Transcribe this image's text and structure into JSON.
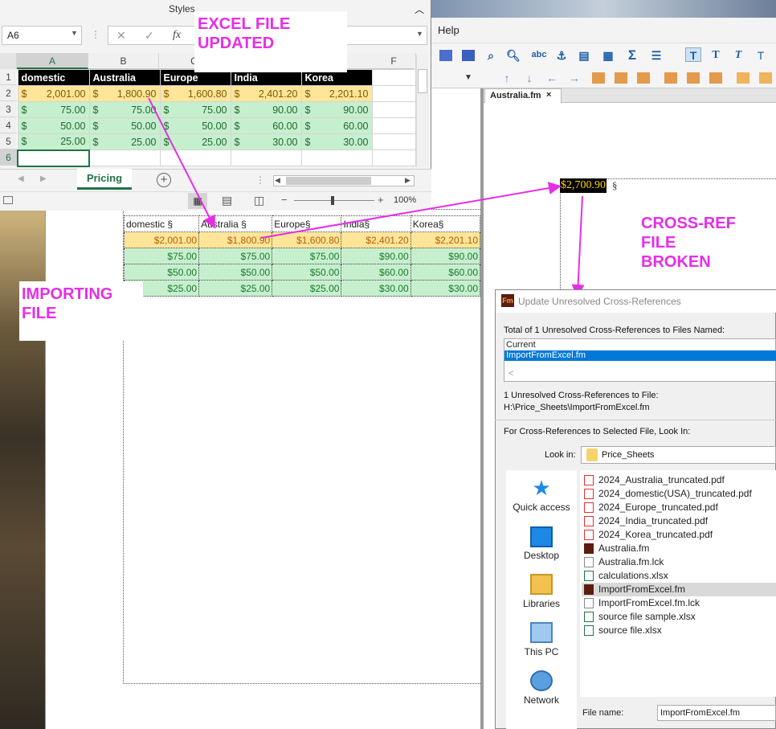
{
  "excel": {
    "ribbon_group": "Styles",
    "name_box": "A6",
    "formula_fx": "fx",
    "columns": [
      "A",
      "B",
      "C",
      "F"
    ],
    "row_numbers": [
      "1",
      "2",
      "3",
      "4",
      "5",
      "6"
    ],
    "header": [
      "domestic",
      "Australia",
      "Europe",
      "India",
      "Korea"
    ],
    "rows": [
      [
        "2,001.00",
        "1,800.90",
        "1,600.80",
        "2,401.20",
        "2,201.10"
      ],
      [
        "75.00",
        "75.00",
        "75.00",
        "90.00",
        "90.00"
      ],
      [
        "50.00",
        "50.00",
        "50.00",
        "60.00",
        "60.00"
      ],
      [
        "25.00",
        "25.00",
        "25.00",
        "30.00",
        "30.00"
      ]
    ],
    "currency_symbol": "$",
    "sheet_tab": "Pricing",
    "add_sheet": "+",
    "zoom": "100%",
    "zoom_minus": "−",
    "zoom_plus": "+"
  },
  "framemaker": {
    "menu_help": "Help",
    "tab_title": "Australia.fm",
    "tab_close": "×",
    "xref_value": "$2,700.90",
    "para_mark": "§",
    "table_header": [
      "domestic §",
      "Australia §",
      "Europe§",
      "India§",
      "Korea§"
    ],
    "table_rows": [
      [
        "$2,001.00",
        "$1,800.90",
        "$1,600.80",
        "$2,401.20",
        "$2,201.10"
      ],
      [
        "$75.00",
        "$75.00",
        "$75.00",
        "$90.00",
        "$90.00"
      ],
      [
        "$50.00",
        "$50.00",
        "$50.00",
        "$60.00",
        "$60.00"
      ],
      [
        "$25.00",
        "$25.00",
        "$25.00",
        "$30.00",
        "$30.00"
      ]
    ],
    "toolbar_text_icons": [
      "abc",
      "Σ",
      "T",
      "T",
      "T",
      "T"
    ]
  },
  "callouts": {
    "excel_updated": [
      "EXCEL FILE",
      "UPDATED"
    ],
    "importing": [
      "IMPORTING",
      "FILE"
    ],
    "crossref_broken": [
      "CROSS-REF",
      "FILE",
      "BROKEN"
    ]
  },
  "dialog": {
    "title": "Update Unresolved Cross-References",
    "icon": "Fm",
    "total_label": "Total of 1 Unresolved Cross-References to Files Named:",
    "list_items": [
      "Current",
      "ImportFromExcel.fm"
    ],
    "selected_index": 1,
    "unresolved_line1": "1 Unresolved Cross-References to File:",
    "unresolved_path": "H:\\Price_Sheets\\ImportFromExcel.fm",
    "look_for_label": "For Cross-References to Selected File, Look In:",
    "look_in_label": "Look in:",
    "look_in_value": "Price_Sheets",
    "places": [
      "Quick access",
      "Desktop",
      "Libraries",
      "This PC",
      "Network"
    ],
    "files": [
      {
        "name": "2024_Australia_truncated.pdf",
        "type": "pdf"
      },
      {
        "name": "2024_domestic(USA)_truncated.pdf",
        "type": "pdf"
      },
      {
        "name": "2024_Europe_truncated.pdf",
        "type": "pdf"
      },
      {
        "name": "2024_India_truncated.pdf",
        "type": "pdf"
      },
      {
        "name": "2024_Korea_truncated.pdf",
        "type": "pdf"
      },
      {
        "name": "Australia.fm",
        "type": "fm"
      },
      {
        "name": "Australia.fm.lck",
        "type": "lck"
      },
      {
        "name": "calculations.xlsx",
        "type": "xlsx"
      },
      {
        "name": "ImportFromExcel.fm",
        "type": "fm",
        "selected": true
      },
      {
        "name": "ImportFromExcel.fm.lck",
        "type": "lck"
      },
      {
        "name": "source file sample.xlsx",
        "type": "xlsx"
      },
      {
        "name": "source file.xlsx",
        "type": "xlsx"
      }
    ],
    "file_name_label": "File name:",
    "file_name_value": "ImportFromExcel.fm"
  },
  "colors": {
    "callout": "#e62ee6",
    "excel_green": "#217346",
    "yellow_row": "#ffe599",
    "green_row": "#c6efce",
    "selection_blue": "#0078d7"
  }
}
